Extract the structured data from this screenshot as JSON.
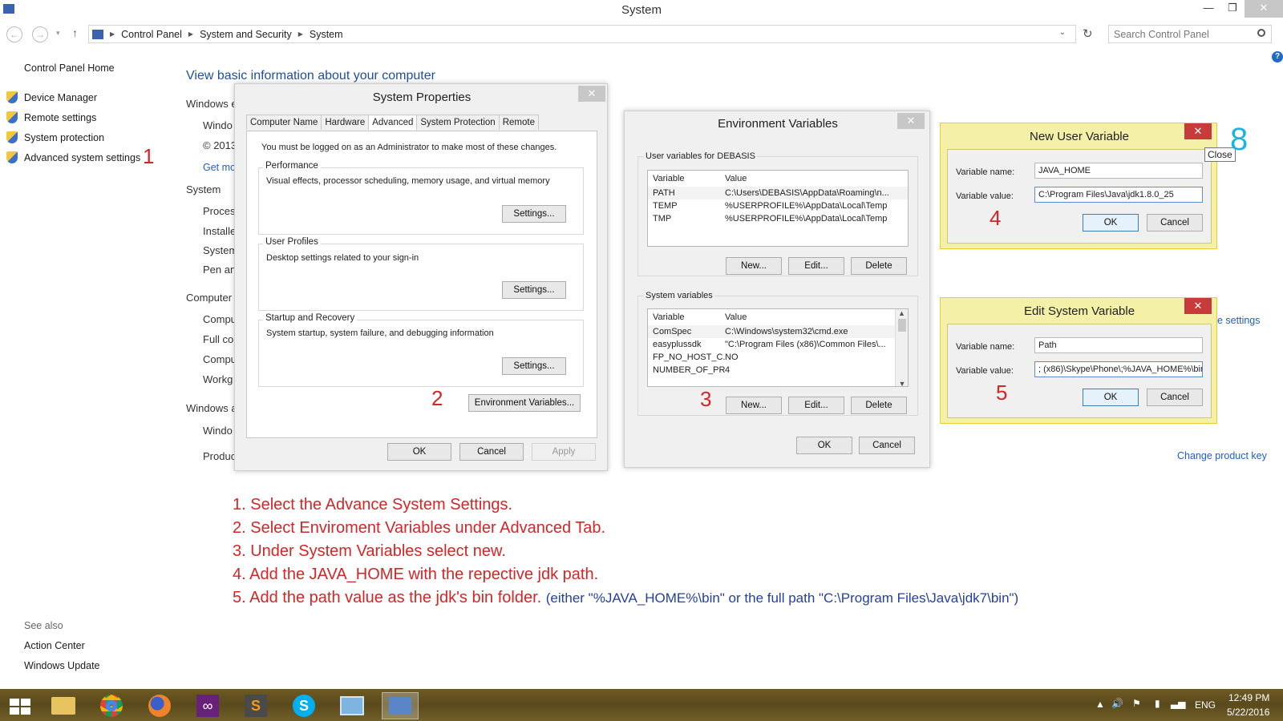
{
  "window": {
    "title": "System",
    "minimize": "—",
    "restore": "❐",
    "close": "✕"
  },
  "address": {
    "crumbs": [
      "Control Panel",
      "System and Security",
      "System"
    ],
    "search_placeholder": "Search Control Panel"
  },
  "left_nav": {
    "home": "Control Panel Home",
    "items": [
      "Device Manager",
      "Remote settings",
      "System protection",
      "Advanced system settings"
    ],
    "see_also": "See also",
    "see_also_items": [
      "Action Center",
      "Windows Update"
    ]
  },
  "main": {
    "heading": "View basic information about your computer",
    "partial": [
      "Windows e",
      "Windo",
      "© 2013",
      "Get mo",
      "System",
      "Process",
      "Installe",
      "System",
      "Pen an",
      "Computer",
      "Compu",
      "Full co",
      "Compu",
      "Workg",
      "Windows a",
      "Windo",
      "Produc"
    ],
    "change_settings": "e settings",
    "change_product_key": "Change product key"
  },
  "system_properties": {
    "title": "System Properties",
    "tabs": [
      "Computer Name",
      "Hardware",
      "Advanced",
      "System Protection",
      "Remote"
    ],
    "admin_note": "You must be logged on as an Administrator to make most of these changes.",
    "performance": {
      "label": "Performance",
      "desc": "Visual effects, processor scheduling, memory usage, and virtual memory",
      "button": "Settings..."
    },
    "user_profiles": {
      "label": "User Profiles",
      "desc": "Desktop settings related to your sign-in",
      "button": "Settings..."
    },
    "startup": {
      "label": "Startup and Recovery",
      "desc": "System startup, system failure, and debugging information",
      "button": "Settings..."
    },
    "env_button": "Environment Variables...",
    "ok": "OK",
    "cancel": "Cancel",
    "apply": "Apply"
  },
  "env_vars": {
    "title": "Environment Variables",
    "user_label": "User variables for DEBASIS",
    "col_variable": "Variable",
    "col_value": "Value",
    "user_rows": [
      {
        "variable": "PATH",
        "value": "C:\\Users\\DEBASIS\\AppData\\Roaming\\n..."
      },
      {
        "variable": "TEMP",
        "value": "%USERPROFILE%\\AppData\\Local\\Temp"
      },
      {
        "variable": "TMP",
        "value": "%USERPROFILE%\\AppData\\Local\\Temp"
      }
    ],
    "system_label": "System variables",
    "system_rows": [
      {
        "variable": "ComSpec",
        "value": "C:\\Windows\\system32\\cmd.exe"
      },
      {
        "variable": "easyplussdk",
        "value": "\"C:\\Program Files (x86)\\Common Files\\..."
      },
      {
        "variable": "FP_NO_HOST_C...",
        "value": "NO"
      },
      {
        "variable": "NUMBER_OF_PR...",
        "value": "4"
      }
    ],
    "new": "New...",
    "edit": "Edit...",
    "delete": "Delete",
    "ok": "OK",
    "cancel": "Cancel"
  },
  "new_user_var": {
    "title": "New User Variable",
    "name_label": "Variable name:",
    "name_value": "JAVA_HOME",
    "value_label": "Variable value:",
    "value_value": "C:\\Program Files\\Java\\jdk1.8.0_25",
    "ok": "OK",
    "cancel": "Cancel",
    "tooltip": "Close"
  },
  "edit_sys_var": {
    "title": "Edit System Variable",
    "name_label": "Variable name:",
    "name_value": "Path",
    "value_label": "Variable value:",
    "value_value": "; (x86)\\Skype\\Phone\\;%JAVA_HOME%\\bin",
    "ok": "OK",
    "cancel": "Cancel"
  },
  "annotations": {
    "marks": [
      "1",
      "2",
      "3",
      "4",
      "5",
      "8"
    ],
    "steps": [
      "1. Select the Advance System Settings.",
      "2. Select Enviroment Variables under Advanced Tab.",
      "3. Under System Variables select new.",
      "4. Add the JAVA_HOME with the repective jdk path.",
      "5. Add the path value as the jdk's bin folder."
    ],
    "step5_note": "(either \"%JAVA_HOME%\\bin\" or the full path \"C:\\Program Files\\Java\\jdk7\\bin\")"
  },
  "taskbar": {
    "lang": "ENG",
    "time": "12:49 PM",
    "date": "5/22/2016"
  },
  "colors": {
    "accent_link": "#1e5fbf",
    "annotation_red": "#d32626",
    "annotation_blue": "#2440a0",
    "dialog_highlight": "#f4f0a8"
  }
}
